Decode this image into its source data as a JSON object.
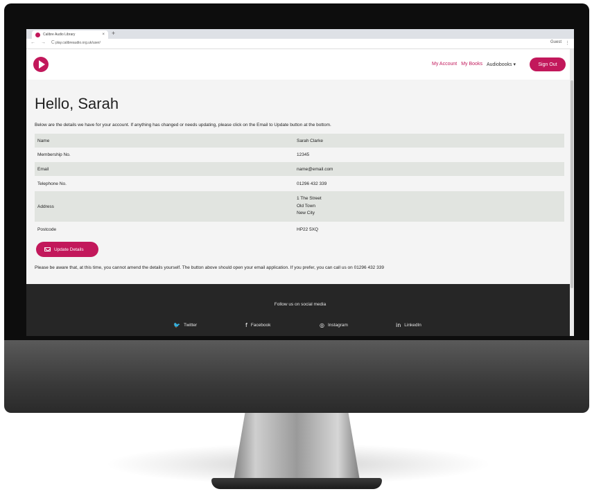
{
  "browser": {
    "tab_title": "Calibre Audio Library",
    "tab_close": "×",
    "new_tab": "+",
    "nav_icons": "← → C",
    "url": "play.calibreaudio.org.uk/user/",
    "profile": "Guest",
    "menu": "⋮"
  },
  "header": {
    "nav": {
      "my_account": "My Account",
      "my_books": "My Books",
      "audiobooks": "Audiobooks ▾"
    },
    "sign_out": "Sign Out",
    "brand_color": "#c2185b"
  },
  "main": {
    "greeting": "Hello, Sarah",
    "intro": "Below are the details we have for your account. If anything has changed or needs updating, please click on the Email to Update button at the bottom.",
    "details": [
      {
        "label": "Name",
        "value": "Sarah Clarke"
      },
      {
        "label": "Membership No.",
        "value": "12345"
      },
      {
        "label": "Email",
        "value": "name@email.com"
      },
      {
        "label": "Telephone No.",
        "value": "01296 432 339"
      },
      {
        "label": "Address",
        "lines": [
          "1 The Street",
          "Old Town",
          "New City"
        ]
      },
      {
        "label": "Postcode",
        "value": "HP22 5XQ"
      }
    ],
    "update_button": "Update Details",
    "notice": "Please be aware that, at this time, you cannot amend the details yourself. The button above should open your email application. If you prefer, you can call us on 01296 432 339"
  },
  "footer": {
    "follow": "Follow us on social media",
    "socials": [
      {
        "label": "Twitter",
        "icon": "twitter-icon",
        "glyph": "🐦"
      },
      {
        "label": "Facebook",
        "icon": "facebook-icon",
        "glyph": "f"
      },
      {
        "label": "Instagram",
        "icon": "instagram-icon",
        "glyph": "◎"
      },
      {
        "label": "LinkedIn",
        "icon": "linkedin-icon",
        "glyph": "in"
      }
    ]
  }
}
